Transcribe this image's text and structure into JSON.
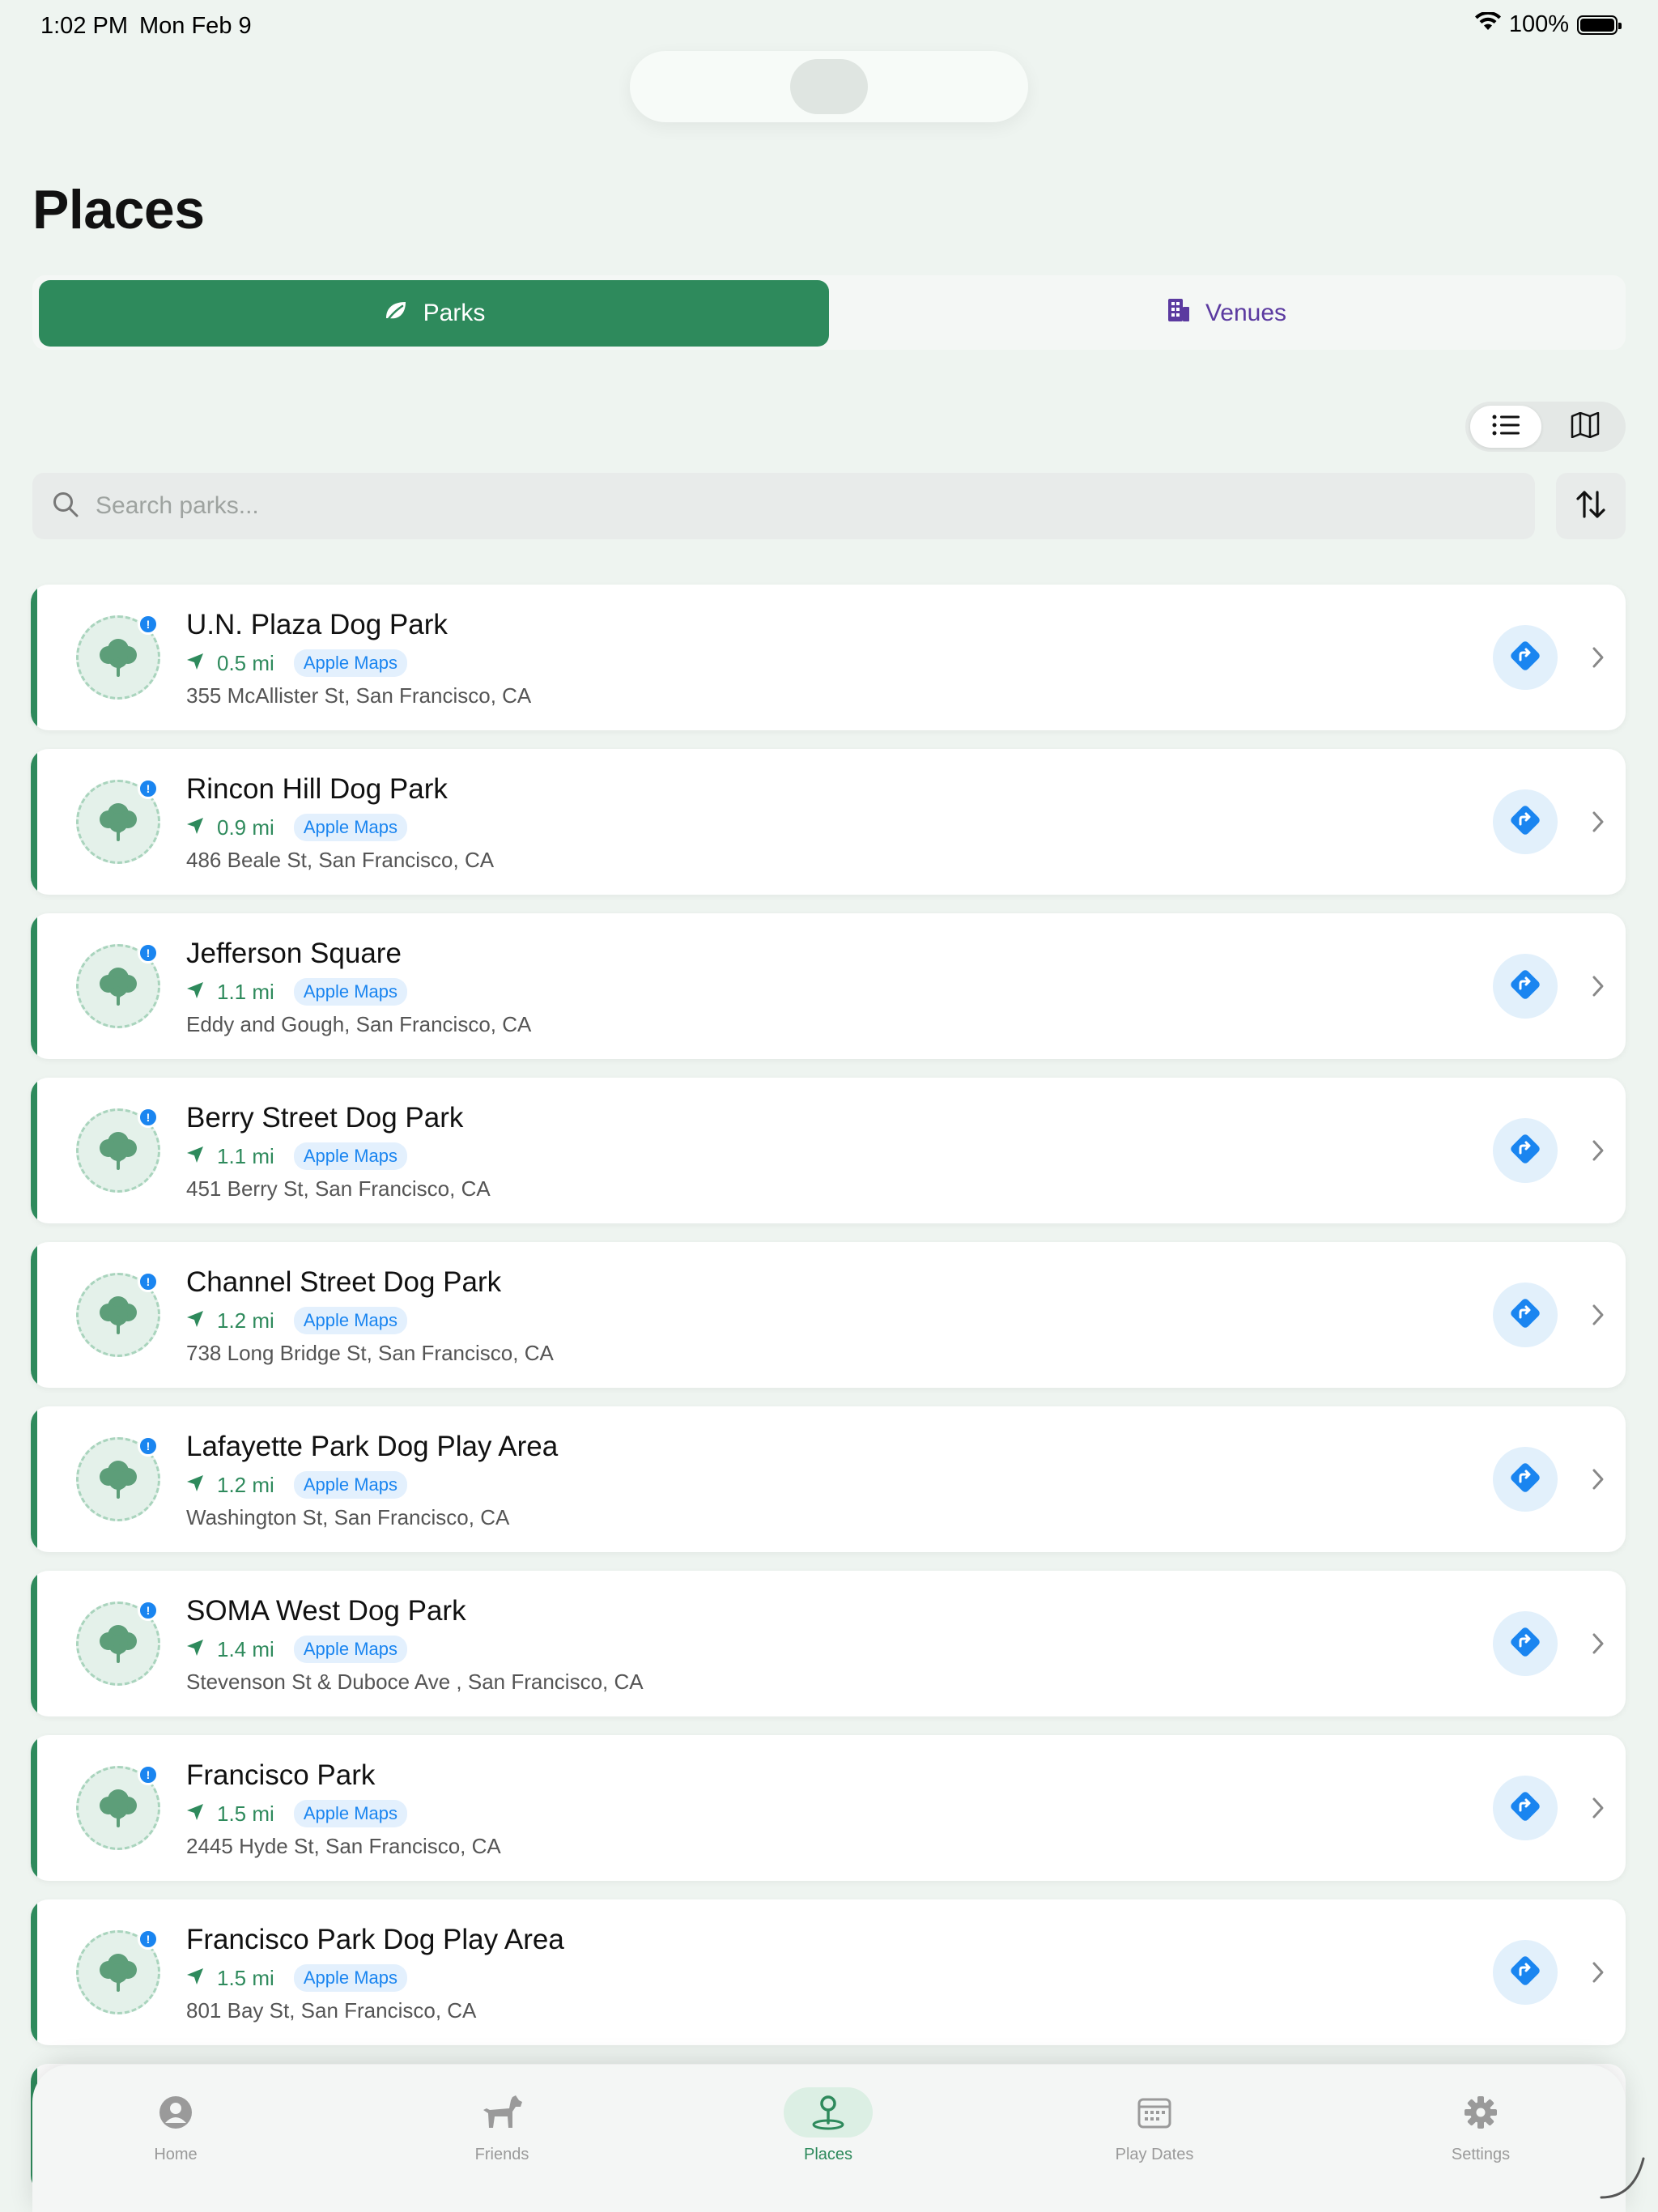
{
  "status": {
    "time": "1:02 PM",
    "date": "Mon Feb 9",
    "battery": "100%"
  },
  "page": {
    "title": "Places"
  },
  "tabs": {
    "parks": "Parks",
    "venues": "Venues",
    "active": "Parks"
  },
  "search": {
    "placeholder": "Search parks..."
  },
  "places": [
    {
      "name": "U.N. Plaza Dog Park",
      "distance": "0.5 mi",
      "source": "Apple Maps",
      "address": "355 McAllister St, San Francisco, CA"
    },
    {
      "name": "Rincon Hill Dog Park",
      "distance": "0.9 mi",
      "source": "Apple Maps",
      "address": "486 Beale St, San Francisco, CA"
    },
    {
      "name": "Jefferson Square",
      "distance": "1.1 mi",
      "source": "Apple Maps",
      "address": "Eddy and Gough, San Francisco, CA"
    },
    {
      "name": "Berry Street Dog Park",
      "distance": "1.1 mi",
      "source": "Apple Maps",
      "address": "451 Berry St, San Francisco, CA"
    },
    {
      "name": "Channel Street Dog Park",
      "distance": "1.2 mi",
      "source": "Apple Maps",
      "address": "738 Long Bridge St, San Francisco, CA"
    },
    {
      "name": "Lafayette Park Dog Play Area",
      "distance": "1.2 mi",
      "source": "Apple Maps",
      "address": "Washington St, San Francisco, CA"
    },
    {
      "name": "SOMA West Dog Park",
      "distance": "1.4 mi",
      "source": "Apple Maps",
      "address": "Stevenson St & Duboce Ave , San Francisco, CA"
    },
    {
      "name": "Francisco Park",
      "distance": "1.5 mi",
      "source": "Apple Maps",
      "address": "2445 Hyde St, San Francisco, CA"
    },
    {
      "name": "Francisco Park Dog Play Area",
      "distance": "1.5 mi",
      "source": "Apple Maps",
      "address": "801 Bay St, San Francisco, CA"
    }
  ],
  "tabbar": {
    "home": "Home",
    "friends": "Friends",
    "places": "Places",
    "play_dates": "Play Dates",
    "settings": "Settings",
    "active": "Places"
  },
  "colors": {
    "brand_green": "#2e8a5c",
    "venues_purple": "#5b3aa0",
    "link_blue": "#1a85f0",
    "background": "#eef4f0"
  },
  "icons": {
    "list_view": "list-icon",
    "map_view": "map-icon",
    "sort": "sort-icon",
    "park": "tree-icon",
    "directions": "directions-icon"
  }
}
